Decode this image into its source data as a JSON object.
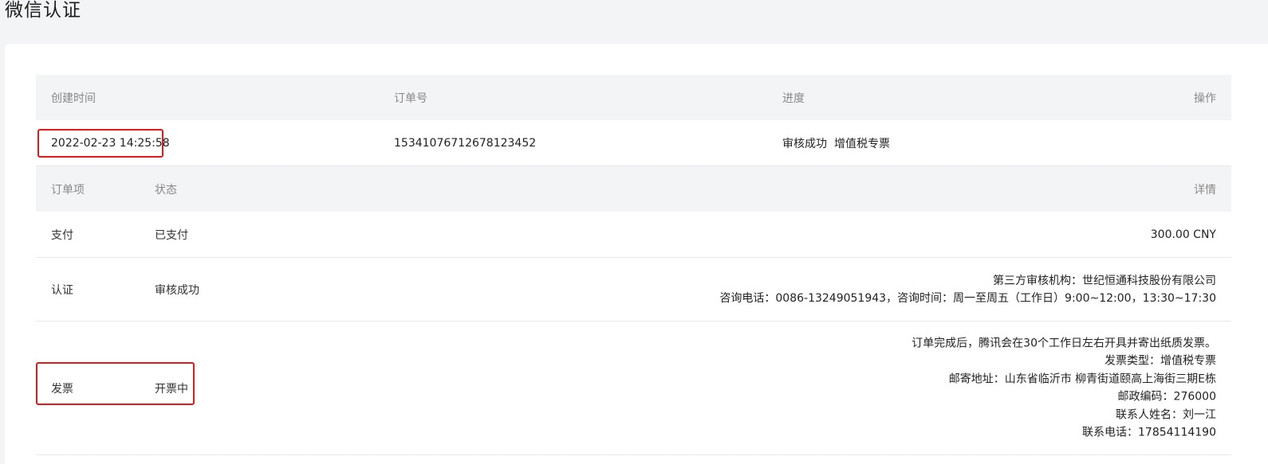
{
  "page": {
    "title": "微信认证"
  },
  "table_header": {
    "created_time": "创建时间",
    "order_no": "订单号",
    "progress": "进度",
    "action": "操作"
  },
  "order": {
    "created_time": "2022-02-23 14:25:58",
    "order_no": "15341076712678123452",
    "progress_status": "审核成功",
    "progress_type": "增值税专票"
  },
  "items_header": {
    "item": "订单项",
    "status": "状态",
    "detail": "详情"
  },
  "items": [
    {
      "item": "支付",
      "status": "已支付",
      "detail_lines": [
        "300.00 CNY"
      ]
    },
    {
      "item": "认证",
      "status": "审核成功",
      "detail_lines": [
        "第三方审核机构：世纪恒通科技股份有限公司",
        "咨询电话：0086-13249051943，咨询时间：周一至周五（工作日）9:00~12:00，13:30~17:30"
      ]
    },
    {
      "item": "发票",
      "status": "开票中",
      "detail_lines": [
        "订单完成后，腾讯会在30个工作日左右开具并寄出纸质发票。",
        "发票类型：增值税专票",
        "邮寄地址：山东省临沂市 柳青街道颐高上海街三期E栋",
        "邮政编码：276000",
        "联系人姓名：刘一江",
        "联系电话：17854114190"
      ]
    }
  ],
  "colors": {
    "highlight": "#e4191c",
    "header_bg": "#f3f4f6",
    "page_bg": "#f3f4f6",
    "card_bg": "#ffffff"
  }
}
